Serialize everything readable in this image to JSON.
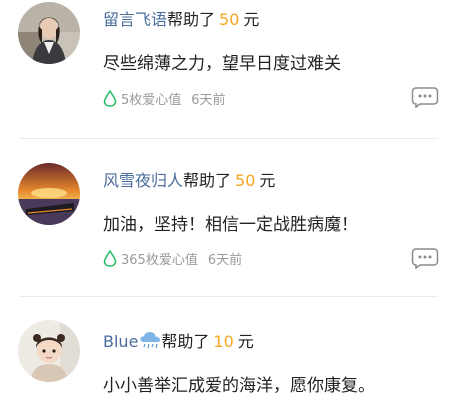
{
  "feed": {
    "items": [
      {
        "nickname": "留言飞语",
        "helped_label": "帮助了",
        "amount": "50",
        "unit": "元",
        "message": "尽些绵薄之力，望早日度过难关",
        "love_value": "5枚爱心值",
        "time": "6天前",
        "avatar_icon": "woman-photo-avatar"
      },
      {
        "nickname": "风雪夜归人",
        "helped_label": "帮助了",
        "amount": "50",
        "unit": "元",
        "message": "加油，坚持！相信一定战胜病魔！",
        "love_value": "365枚爱心值",
        "time": "6天前",
        "avatar_icon": "sunset-landscape-avatar"
      },
      {
        "nickname": "Blue",
        "nickname_emoji": "rain-cloud-icon",
        "helped_label": "帮助了",
        "amount": "10",
        "unit": "元",
        "message": "小小善举汇成爱的海洋，愿你康复。",
        "avatar_icon": "child-photo-avatar"
      }
    ]
  },
  "colors": {
    "nickname": "#4a6d9c",
    "amount": "#f5a623",
    "drop_icon": "#2bbf6d",
    "meta_text": "#9a9a9a",
    "divider": "#ebebeb"
  },
  "icons": {
    "love_drop": "water-drop-icon",
    "comment": "comment-bubble-icon"
  }
}
